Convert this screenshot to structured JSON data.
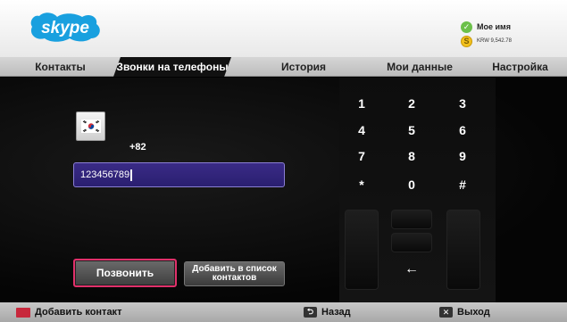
{
  "app": {
    "logo_text": "skype",
    "user_name": "Мое имя",
    "balance": "KRW 9,542.78"
  },
  "tabs": [
    {
      "label": "Контакты",
      "active": false
    },
    {
      "label": "Звонки на телефоны",
      "active": true
    },
    {
      "label": "История",
      "active": false
    },
    {
      "label": "Мои данные",
      "active": false
    },
    {
      "label": "Настройка",
      "active": false
    }
  ],
  "dial": {
    "country_flag": "south-korea-flag-icon",
    "country_code": "+82",
    "number_value": "123456789"
  },
  "actions": {
    "call_label": "Позвонить",
    "add_contact_label": "Добавить в список контактов"
  },
  "keypad": {
    "keys": [
      "1",
      "2",
      "3",
      "4",
      "5",
      "6",
      "7",
      "8",
      "9",
      "*",
      "0",
      "#"
    ],
    "backspace_label": "←"
  },
  "footer": {
    "add_contact": "Добавить контакт",
    "back": "Назад",
    "exit": "Выход"
  },
  "colors": {
    "accent_pink": "#e0306a",
    "input_purple": "#2f2379",
    "skype_blue": "#1aa8e6"
  }
}
